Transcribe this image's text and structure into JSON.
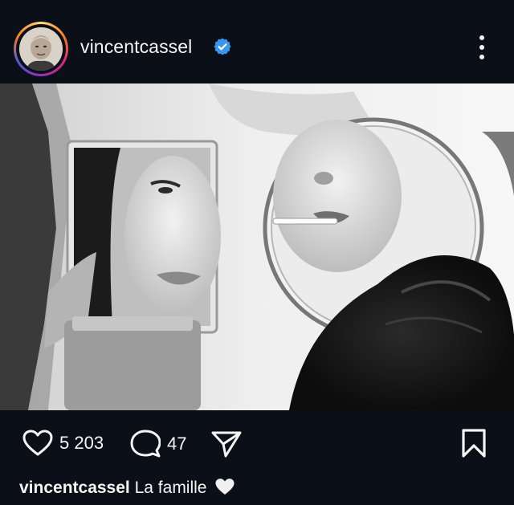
{
  "post": {
    "username": "vincentcassel",
    "verified": true,
    "photo_alt": "",
    "likes": "5 203",
    "comments": "47",
    "caption_user": "vincentcassel",
    "caption_text": "La famille",
    "caption_emoji": "white-heart-icon"
  },
  "icons": {
    "verified": "verified-badge-icon",
    "more": "more-options-icon",
    "like": "heart-icon",
    "comment": "comment-icon",
    "share": "share-icon",
    "save": "bookmark-icon"
  },
  "colors": {
    "background": "#0b0f17",
    "text": "#f5f5f5",
    "verified": "#3897f0"
  }
}
